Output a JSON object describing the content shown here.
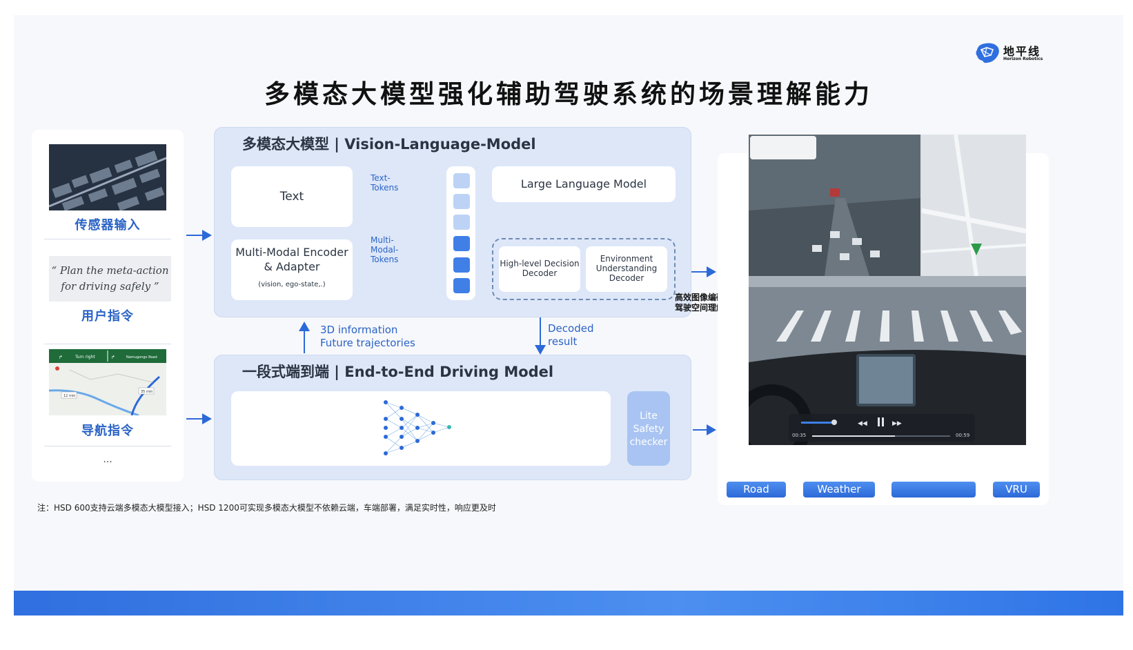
{
  "logo": {
    "name_cn": "地平线",
    "name_en": "Horizon Robotics"
  },
  "title": "多模态大模型强化辅助驾驶系统的场景理解能力",
  "inputs": {
    "sensor_label": "传感器输入",
    "quote": "“ Plan the meta-action for driving safely ”",
    "command_label": "用户指令",
    "nav_label": "导航指令",
    "nav_signs": [
      "Turn right",
      "Namugongo Road"
    ],
    "nav_distances": [
      "12 min",
      "35 min"
    ],
    "ellipsis": "..."
  },
  "vlm": {
    "title": "多模态大模型 | Vision-Language-Model",
    "text_card": "Text",
    "encoder_title": "Multi-Modal Encoder & Adapter",
    "encoder_sub": "(vision, ego-state,.)",
    "text_tokens": "Text- Tokens",
    "mm_tokens": "Multi- Modal- Tokens",
    "llm": "Large Language Model",
    "decoder1": "High-level Decision Decoder",
    "decoder2": "Environment Understanding Decoder"
  },
  "middle": {
    "info": "3D information Future trajectories",
    "decoded": "Decoded result"
  },
  "e2e": {
    "title": "一段式端到端 | End-to-End Driving Model",
    "lite": "Lite Safety checker"
  },
  "video": {
    "note": "高效图像编码 | 驾驶空间理解",
    "time_start": "00:35",
    "time_end": "00:59",
    "progress": 0.6
  },
  "tags": [
    "Road",
    "Weather",
    "",
    "VRU"
  ],
  "footnote": "注：HSD 600支持云端多模态大模型接入；HSD 1200可实现多模态大模型不依赖云端，车端部署，满足实时性，响应更及时",
  "colors": {
    "accent": "#2a63c6",
    "token_dark": "#3f7fe6",
    "token_light": "#bcd3f6",
    "bar": "#2f6fdf"
  }
}
